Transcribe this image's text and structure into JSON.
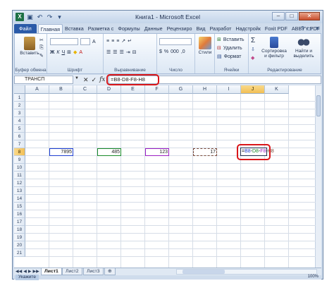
{
  "window": {
    "title": "Книга1 - Microsoft Excel",
    "app_icon": "X",
    "controls": {
      "minimize": "–",
      "maximize": "□",
      "close": "✕"
    }
  },
  "tabs": [
    {
      "label": "Файл",
      "kind": "file"
    },
    {
      "label": "Главная",
      "kind": "active"
    },
    {
      "label": "Вставка",
      "kind": ""
    },
    {
      "label": "Разметка с",
      "kind": ""
    },
    {
      "label": "Формулы",
      "kind": ""
    },
    {
      "label": "Данные",
      "kind": ""
    },
    {
      "label": "Рецензиро",
      "kind": ""
    },
    {
      "label": "Вид",
      "kind": ""
    },
    {
      "label": "Разработ",
      "kind": ""
    },
    {
      "label": "Надстройк",
      "kind": ""
    },
    {
      "label": "Foxit PDF",
      "kind": ""
    },
    {
      "label": "ABBYY PDF",
      "kind": ""
    }
  ],
  "ribbon": {
    "paste_label": "Вставить",
    "clipboard_label": "Буфер обмена",
    "font_label": "Шрифт",
    "align_label": "Выравнивание",
    "number_label": "Число",
    "styles_btn": "Стили",
    "cells_label": "Ячейки",
    "insert_btn": "Вставить",
    "delete_btn": "Удалить",
    "format_btn": "Формат",
    "sort_btn": "Сортировка и фильтр",
    "find_btn": "Найти и выделить",
    "editing_label": "Редактирование",
    "sum_glyph": "Σ"
  },
  "formula_bar": {
    "name_box": "ТРАНСП",
    "cancel": "✕",
    "enter": "✓",
    "fx": "fx",
    "formula": "=B8-D8-F8-H8"
  },
  "grid": {
    "columns": [
      "A",
      "B",
      "C",
      "D",
      "E",
      "F",
      "G",
      "H",
      "I",
      "J",
      "K"
    ],
    "selected_column": "J",
    "rows": [
      "1",
      "2",
      "3",
      "4",
      "5",
      "6",
      "7",
      "8",
      "9",
      "10",
      "11",
      "12",
      "13",
      "14",
      "15",
      "16",
      "17",
      "18",
      "19",
      "20",
      "21"
    ],
    "selected_row": "8",
    "cells": {
      "B8": "7895",
      "D8": "485",
      "F8": "123",
      "H8": "17",
      "J8": "=B8-D8-F8-H8"
    },
    "ref_colors": {
      "B8": "#1f3fd1",
      "D8": "#1a8a2a",
      "F8": "#9b1fc4",
      "H8": "#7a4a3a"
    },
    "formula_parts": [
      {
        "text": "=",
        "color": "#000000"
      },
      {
        "text": "B8",
        "color": "#1f3fd1"
      },
      {
        "text": "-",
        "color": "#000000"
      },
      {
        "text": "D8",
        "color": "#1a8a2a"
      },
      {
        "text": "-",
        "color": "#000000"
      },
      {
        "text": "F8",
        "color": "#9b1fc4"
      },
      {
        "text": "-",
        "color": "#000000"
      },
      {
        "text": "H8",
        "color": "#7a4a3a"
      }
    ]
  },
  "sheets": [
    "Лист1",
    "Лист2",
    "Лист3"
  ],
  "active_sheet": "Лист1",
  "status": {
    "mode": "Укажите",
    "zoom": "100%"
  },
  "highlight_color": "#d9161a"
}
